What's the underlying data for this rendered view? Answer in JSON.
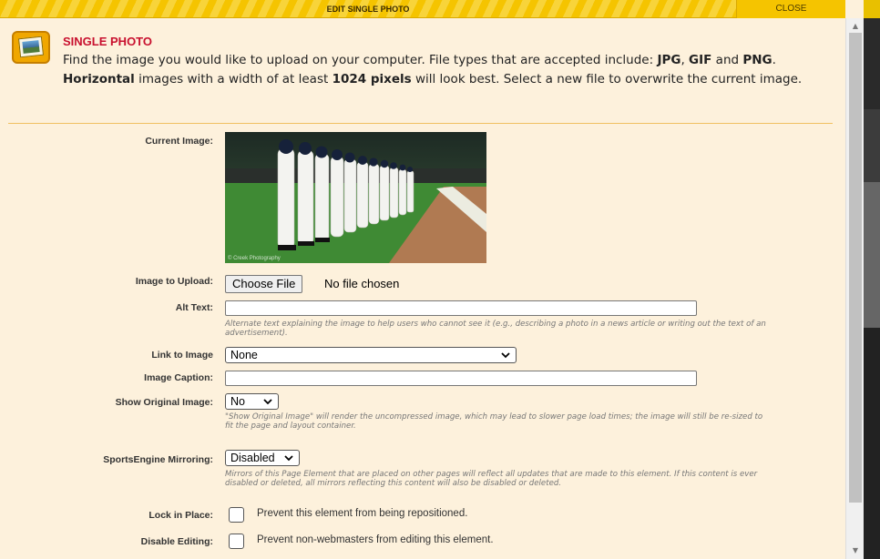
{
  "window": {
    "title": "EDIT SINGLE PHOTO",
    "close_label": "CLOSE"
  },
  "intro": {
    "icon": "photo-album-icon",
    "title": "SINGLE PHOTO",
    "text_1": "Find the image you would like to upload on your computer. File types that are accepted include: ",
    "jpg": "JPG",
    "comma": ",",
    "gif": "GIF",
    "and": " and ",
    "png": "PNG",
    "dot": ". ",
    "horizontal": "Horizontal",
    "text_2": " images with a width of at least ",
    "pixels": "1024 pixels",
    "text_3": " will look best. Select a new file to overwrite the current image."
  },
  "form": {
    "current_image": {
      "label": "Current Image:",
      "credit": "© Creek Photography"
    },
    "image_upload": {
      "label": "Image to Upload:",
      "button": "Choose File",
      "status": "No file chosen"
    },
    "alt_text": {
      "label": "Alt Text:",
      "value": "",
      "help": "Alternate text explaining the image to help users who cannot see it (e.g., describing a photo in a news article or writing out the text of an advertisement)."
    },
    "link_to_image": {
      "label": "Link to Image",
      "value": "None"
    },
    "image_caption": {
      "label": "Image Caption:",
      "value": ""
    },
    "show_original": {
      "label": "Show Original Image:",
      "value": "No",
      "help": "\"Show Original Image\" will render the uncompressed image, which may lead to slower page load times; the image will still be re-sized to fit the page and layout container."
    },
    "mirroring": {
      "label": "SportsEngine Mirroring:",
      "value": "Disabled",
      "help": "Mirrors of this Page Element that are placed on other pages will reflect all updates that are made to this element. If this content is ever disabled or deleted, all mirrors reflecting this content will also be disabled or deleted."
    },
    "lock_in_place": {
      "label": "Lock in Place:",
      "checkbox_label": "Prevent this element from being repositioned.",
      "checked": false
    },
    "disable_editing": {
      "label": "Disable Editing:",
      "checkbox_label": "Prevent non-webmasters from editing this element.",
      "checked": false
    }
  },
  "colors": {
    "header_yellow": "#f5c400",
    "panel_bg": "#fdf1dc",
    "title_red": "#c8102e"
  }
}
